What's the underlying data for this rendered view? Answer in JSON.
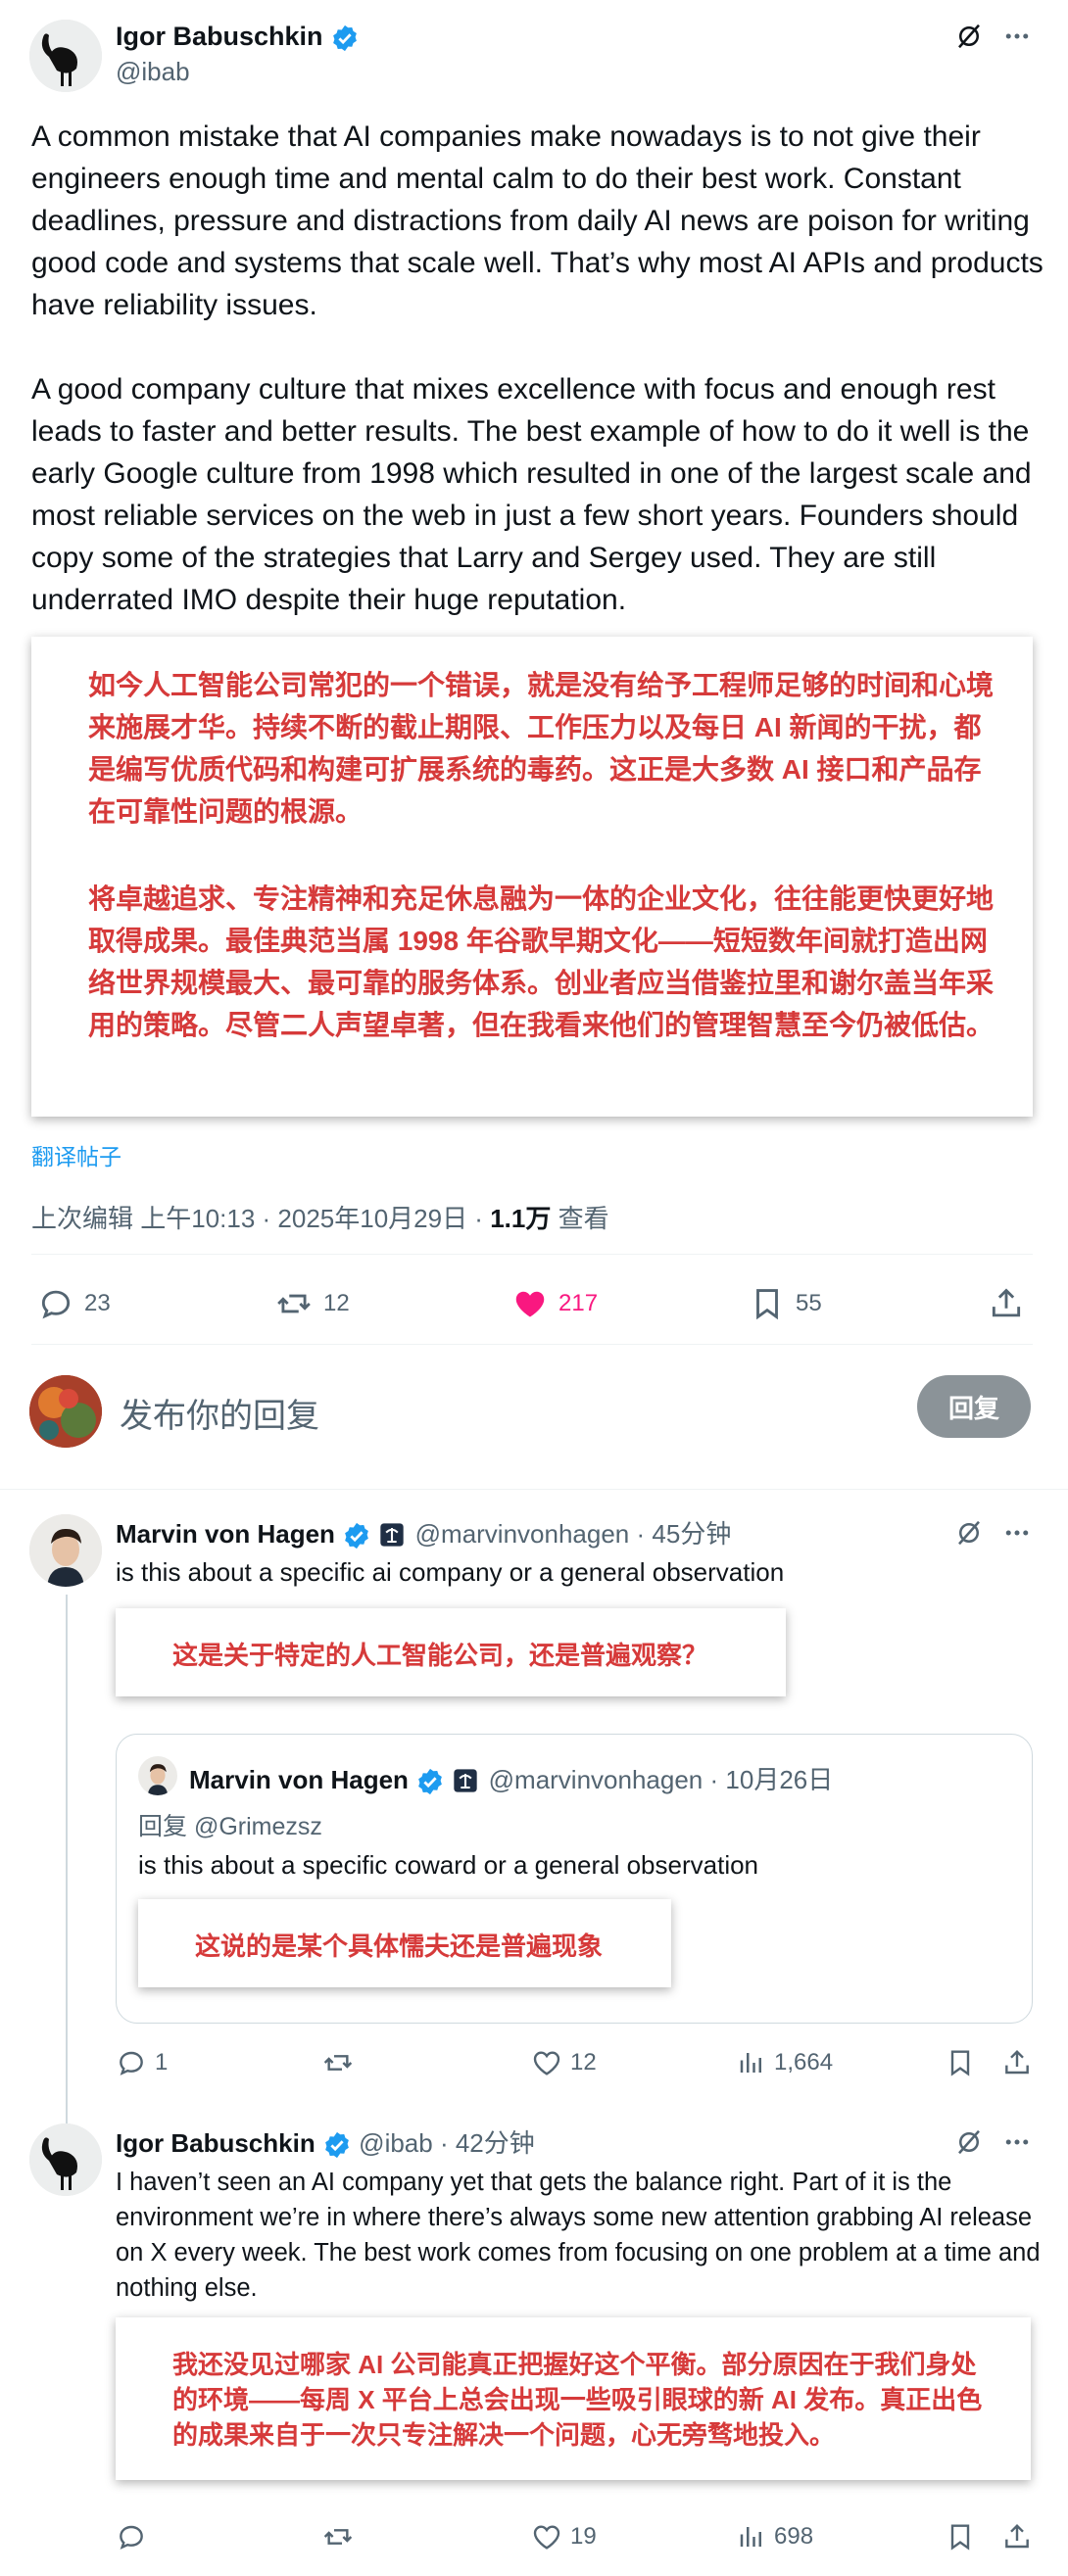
{
  "main_post": {
    "author_name": "Igor Babuschkin",
    "handle": "@ibab",
    "paragraph1": "A common mistake that AI companies make nowadays is to not give their engineers enough time and mental calm to do their best work. Constant deadlines, pressure and distractions from daily AI news are poison for writing good code and systems that scale well. That’s why most AI APIs and products have reliability issues.",
    "paragraph2": "A good company culture that mixes excellence with focus and enough rest leads to faster and better results. The best example of how to do it well is the early Google culture from 1998 which resulted in one of the largest scale and most reliable services on the web in just a few short years. Founders should copy some of the strategies that Larry and Sergey used. They are still underrated IMO despite their huge reputation.",
    "translation_p1": "如今人工智能公司常犯的一个错误，就是没有给予工程师足够的时间和心境来施展才华。持续不断的截止期限、工作压力以及每日 AI 新闻的干扰，都是编写优质代码和构建可扩展系统的毒药。这正是大多数 AI 接口和产品存在可靠性问题的根源。",
    "translation_p2": "将卓越追求、专注精神和充足休息融为一体的企业文化，往往能更快更好地取得成果。最佳典范当属 1998 年谷歌早期文化——短短数年间就打造出网络世界规模最大、最可靠的服务体系。创业者应当借鉴拉里和谢尔盖当年采用的策略。尽管二人声望卓著，但在我看来他们的管理智慧至今仍被低估。",
    "translate_link": "翻译帖子",
    "meta_prefix": "上次编辑 上午10:13 · 2025年10月29日 · ",
    "views_count": "1.1万",
    "views_label": "查看",
    "stats": {
      "replies": "23",
      "reposts": "12",
      "likes": "217",
      "bookmarks": "55"
    }
  },
  "reply_box": {
    "placeholder": "发布你的回复",
    "button": "回复"
  },
  "reply1": {
    "author_name": "Marvin von Hagen",
    "handle": "@marvinvonhagen",
    "time": "· 45分钟",
    "text": "is this about a specific ai company or a general observation",
    "translation": "这是关于特定的人工智能公司，还是普遍观察？",
    "quote": {
      "author_name": "Marvin von Hagen",
      "handle": "@marvinvonhagen",
      "time": "· 10月26日",
      "reply_to": "回复 @Grimezsz",
      "text": "is this about a specific coward or a general observation",
      "translation": "这说的是某个具体懦夫还是普遍现象"
    },
    "stats": {
      "replies": "1",
      "reposts": "",
      "likes": "12",
      "views": "1,664"
    }
  },
  "reply2": {
    "author_name": "Igor Babuschkin",
    "handle": "@ibab",
    "time": "· 42分钟",
    "text": "I haven’t seen an AI company yet that gets the balance right. Part of it is the environment we’re in where there’s always some new attention grabbing AI release on X every week. The best work comes from focusing on one problem at a time and nothing else.",
    "translation": "我还没见过哪家 AI 公司能真正把握好这个平衡。部分原因在于我们身处的环境——每周 X 平台上总会出现一些吸引眼球的新 AI 发布。真正出色的成果来自于一次只专注解决一个问题，心无旁骛地投入。",
    "stats": {
      "replies": "",
      "reposts": "",
      "likes": "19",
      "views": "698"
    }
  },
  "colors": {
    "accent": "#1d9bf0",
    "like": "#f91880",
    "translation_text": "#d63a3a",
    "text": "#0f1419",
    "secondary": "#536471"
  },
  "icons": [
    "grok-icon",
    "more-icon",
    "verified-icon",
    "reply-icon",
    "repost-icon",
    "like-icon",
    "bookmark-icon",
    "share-icon",
    "views-icon",
    "affiliate-badge-icon"
  ]
}
